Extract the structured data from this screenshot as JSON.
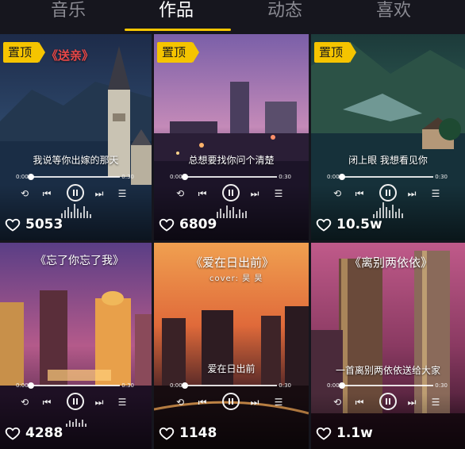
{
  "tabs": [
    {
      "label": "音乐",
      "active": false
    },
    {
      "label": "作品",
      "active": true
    },
    {
      "label": "动态",
      "active": false
    },
    {
      "label": "喜欢",
      "active": false
    }
  ],
  "accent_color": "#f5c400",
  "cards": [
    {
      "pinned": true,
      "pin_label": "置顶",
      "title": "《送亲》",
      "title_color": "red",
      "subtitle": "",
      "lyric": "我说等你出嫁的那天",
      "likes": "5053",
      "scene": "mountain-lake-church"
    },
    {
      "pinned": true,
      "pin_label": "置顶",
      "title": "",
      "subtitle": "",
      "lyric": "总想要找你问个清楚",
      "likes": "6809",
      "scene": "city-dusk-purple"
    },
    {
      "pinned": true,
      "pin_label": "置顶",
      "title": "",
      "subtitle": "",
      "lyric": "闭上眼 我想看见你",
      "likes": "10.5w",
      "scene": "alpine-lake-village"
    },
    {
      "pinned": false,
      "pin_label": "",
      "title": "《忘了你忘了我》",
      "subtitle": "",
      "lyric": "",
      "likes": "4288",
      "scene": "city-night-gold"
    },
    {
      "pinned": false,
      "pin_label": "",
      "title": "《爱在日出前》",
      "subtitle": "cover: 昊 昊",
      "lyric": "爱在日出前",
      "likes": "1148",
      "scene": "city-sunset-orange"
    },
    {
      "pinned": false,
      "pin_label": "",
      "title": "《离别两依依》",
      "subtitle": "",
      "lyric": "一首离别两依依送给大家",
      "likes": "1.1w",
      "scene": "skyscrapers-pink"
    }
  ],
  "player": {
    "time_start": "0:00",
    "time_end": "0:30"
  }
}
